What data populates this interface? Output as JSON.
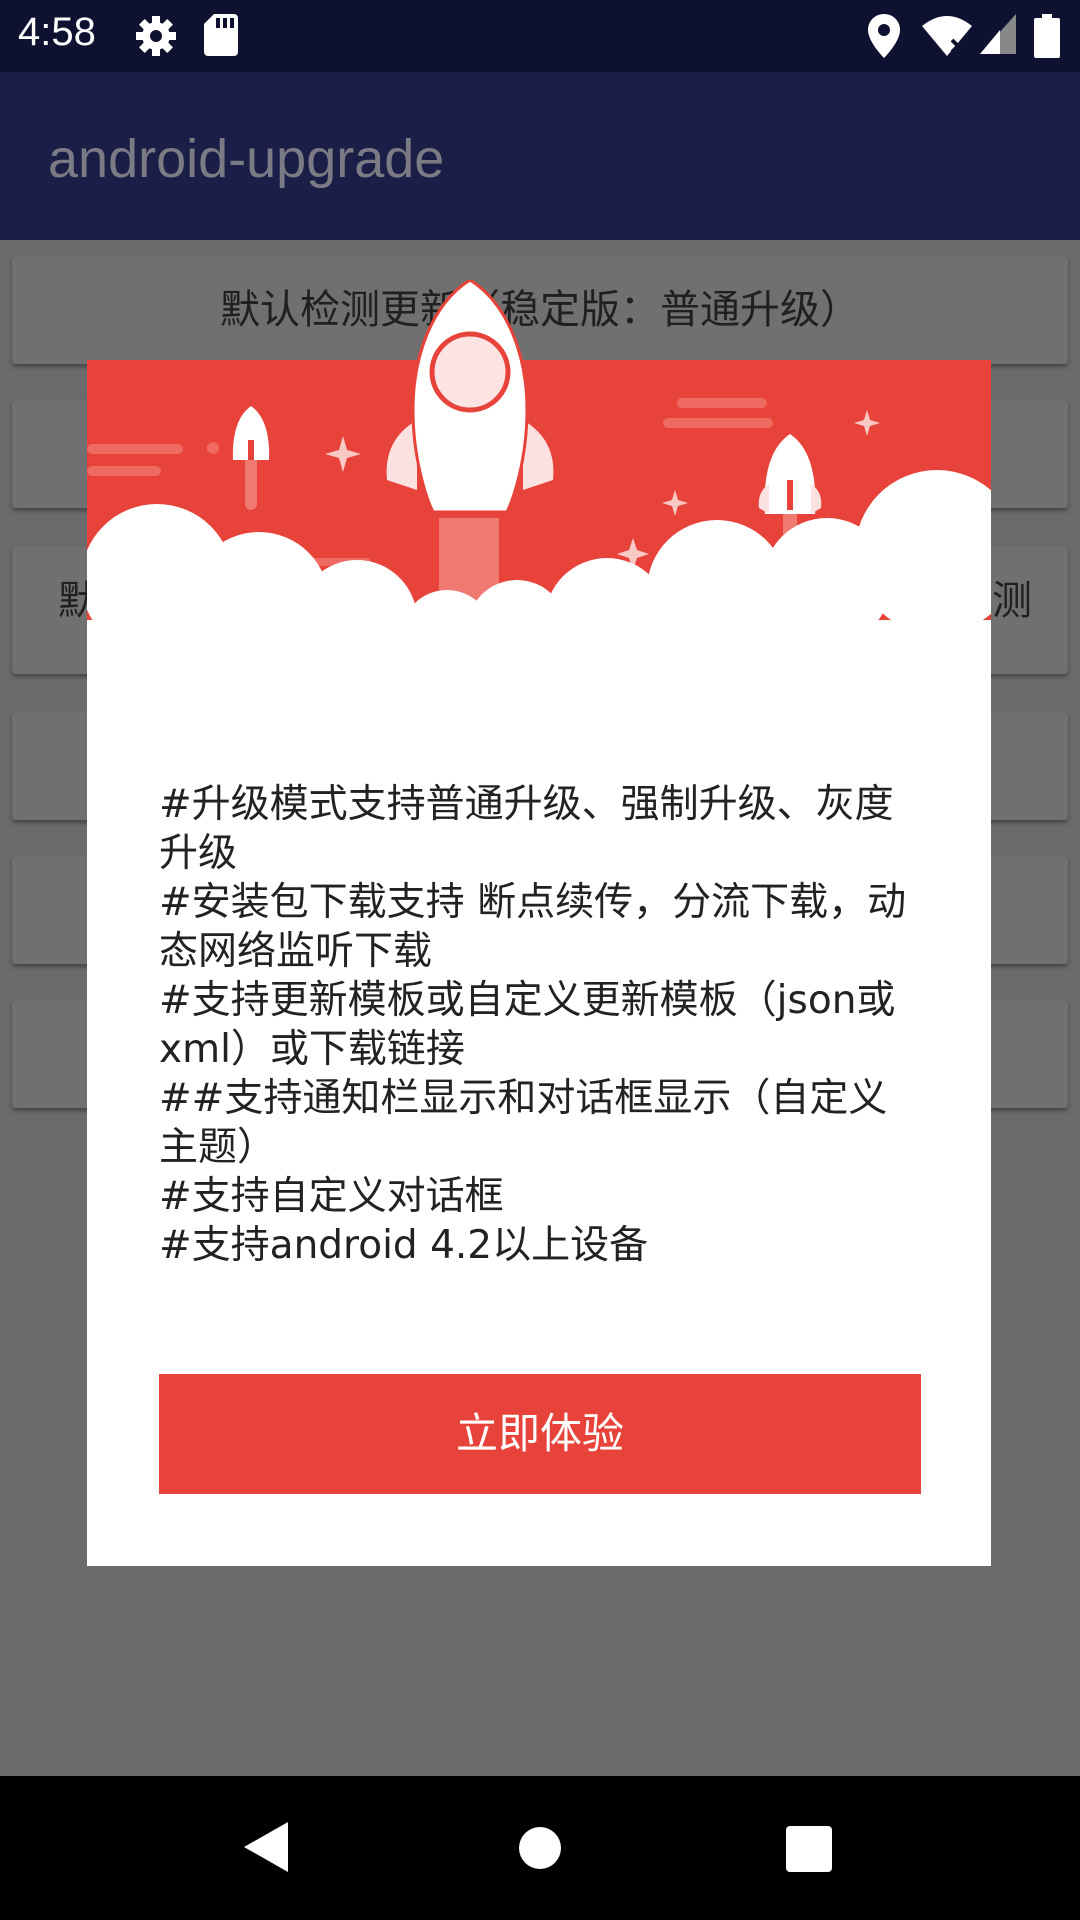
{
  "status_bar": {
    "time": "4:58",
    "icons": [
      "settings-icon",
      "sd-card-icon",
      "location-icon",
      "wifi-icon",
      "signal-icon",
      "battery-icon"
    ]
  },
  "app_bar": {
    "title": "android-upgrade"
  },
  "background_buttons": [
    {
      "label": "默认检测更新（稳定版：普通升级）"
    },
    {
      "label": ""
    },
    {
      "label_left": "默",
      "label_right": "测"
    },
    {
      "label": ""
    },
    {
      "label": ""
    },
    {
      "label": ""
    }
  ],
  "dialog": {
    "lines": [
      "#升级模式支持普通升级、强制升级、灰度升级",
      "#安装包下载支持 断点续传，分流下载，动态网络监听下载",
      "#支持更新模板或自定义更新模板（json或xml）或下载链接",
      "##支持通知栏显示和对话框显示（自定义主题）",
      "#支持自定义对话框",
      "#支持android 4.2以上设备"
    ],
    "confirm_label": "立即体验",
    "header_color": "#e8433a",
    "button_color": "#e8433a"
  },
  "nav_bar": {
    "icons": [
      "back-icon",
      "home-icon",
      "recents-icon"
    ]
  }
}
